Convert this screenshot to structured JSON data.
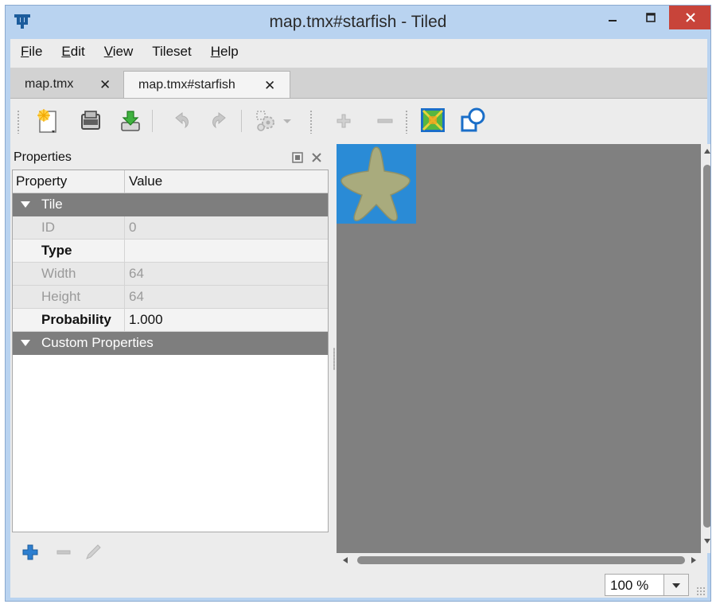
{
  "window": {
    "title": "map.tmx#starfish - Tiled",
    "controls": {
      "minimize": "minimize-icon",
      "maximize": "maximize-icon",
      "close": "close-icon"
    }
  },
  "menu": [
    {
      "accel": "F",
      "rest": "ile"
    },
    {
      "accel": "E",
      "rest": "dit"
    },
    {
      "accel": "V",
      "rest": "iew"
    },
    {
      "accel": "",
      "rest": "Tileset"
    },
    {
      "accel": "H",
      "rest": "elp"
    }
  ],
  "tabs": [
    {
      "label": "map.tmx",
      "close": "✕",
      "active": false
    },
    {
      "label": "map.tmx#starfish",
      "close": "✕",
      "active": true
    }
  ],
  "toolbar": {
    "icons": [
      "new-file-icon",
      "open-icon",
      "save-icon",
      "undo-icon",
      "redo-icon",
      "commands-icon",
      "dropdown-arrow-icon",
      "zoom-in-icon",
      "zoom-out-icon",
      "tileset-image-icon",
      "collision-editor-icon"
    ]
  },
  "properties": {
    "title": "Properties",
    "columns": {
      "property": "Property",
      "value": "Value"
    },
    "groups": [
      {
        "label": "Tile",
        "rows": [
          {
            "name": "ID",
            "value": "0",
            "editable": false
          },
          {
            "name": "Type",
            "value": "",
            "editable": true
          },
          {
            "name": "Width",
            "value": "64",
            "editable": false
          },
          {
            "name": "Height",
            "value": "64",
            "editable": false
          },
          {
            "name": "Probability",
            "value": "1.000",
            "editable": true
          }
        ]
      },
      {
        "label": "Custom Properties",
        "rows": []
      }
    ]
  },
  "canvas": {
    "tile": "starfish-tile",
    "tile_bg": "#2a8bd6",
    "bg": "#808080"
  },
  "status": {
    "zoom": "100 %"
  },
  "colors": {
    "title_bar": "#b9d3f0",
    "close_button": "#c8443a",
    "group_header": "#7e7e7e",
    "accent": "#2a8bd6"
  }
}
